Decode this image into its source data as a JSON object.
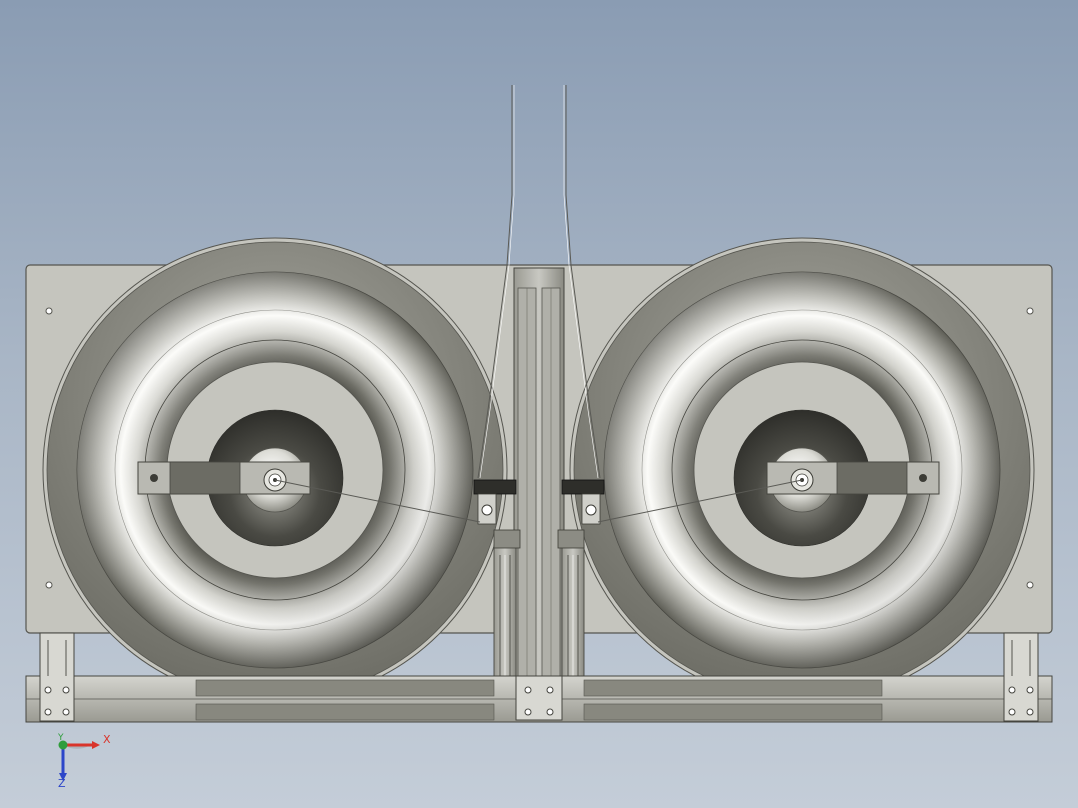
{
  "colors": {
    "background_top": "#8a9cb3",
    "background_bottom": "#c4cdd8",
    "plate": "#c5c5be",
    "plate_edge": "#55554f",
    "steel_light": "#f2f2ee",
    "steel_dark": "#5e5e56",
    "axis_x": "#d9342b",
    "axis_y": "#2f9d3c",
    "axis_z": "#2c46c9"
  },
  "triad": {
    "x_label": "X",
    "y_label": "Y",
    "z_label": "Z"
  },
  "icons": {
    "reel_left": "spool-reel-icon",
    "reel_right": "spool-reel-icon",
    "triad": "coordinate-triad-icon"
  }
}
